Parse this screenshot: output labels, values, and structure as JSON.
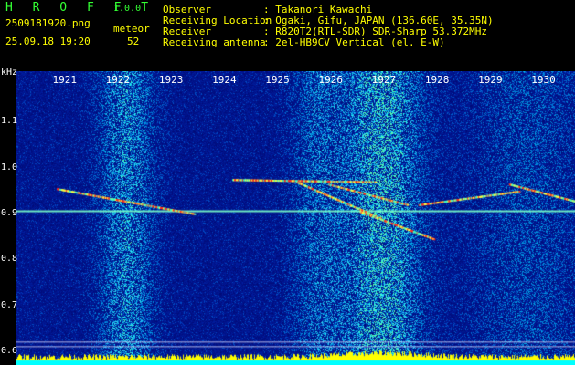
{
  "header": {
    "app_title": "H R O F F T",
    "app_version": "1.0.0",
    "file_name": "2509181920.png",
    "timestamp": "25.09.18 19:20",
    "meteor_label": "meteor",
    "meteor_count": "52",
    "info": [
      {
        "label": "Observer",
        "value": ": Takanori Kawachi"
      },
      {
        "label": "Receiving Location",
        "value": ": Ogaki, Gifu, JAPAN (136.60E, 35.35N)"
      },
      {
        "label": "Receiver",
        "value": ": R820T2(RTL-SDR) SDR-Sharp 53.372MHz"
      },
      {
        "label": "Receiving antenna",
        "value": ": 2el-HB9CV Vertical (el. E-W)"
      }
    ]
  },
  "colors": {
    "background": "#000000",
    "noise_base": "#0a1a8c",
    "title_green": "#33ff33",
    "timestamp_yellow": "#ffff00",
    "echo_red": "#ff3020",
    "echo_yellow": "#ffff40",
    "bottom_band_yellow": "#ffff00",
    "bottom_band_cyan": "#00ffff"
  },
  "chart_data": {
    "type": "heatmap",
    "ylabel": "kHz",
    "y_ticks": [
      "1.1",
      "1.0",
      "0.9",
      "0.8",
      "0.7",
      "0.6"
    ],
    "x_ticks": [
      "1921",
      "1922",
      "1923",
      "1924",
      "1925",
      "1926",
      "1927",
      "1928",
      "1929",
      "1930"
    ],
    "xlim": [
      "19:20",
      "19:30"
    ],
    "ylim": [
      0.57,
      1.21
    ],
    "grid": false,
    "carrier_khz": 0.905,
    "echoes": [
      {
        "t0": 0.0,
        "f0": 0.955,
        "t1": 2.6,
        "f1": 0.9
      },
      {
        "t0": 3.3,
        "f0": 0.975,
        "t1": 6.0,
        "f1": 0.97
      },
      {
        "t0": 4.5,
        "f0": 0.97,
        "t1": 6.1,
        "f1": 0.89
      },
      {
        "t0": 5.1,
        "f0": 0.965,
        "t1": 6.6,
        "f1": 0.92
      },
      {
        "t0": 6.8,
        "f0": 0.92,
        "t1": 8.7,
        "f1": 0.95
      },
      {
        "t0": 8.5,
        "f0": 0.965,
        "t1": 10.0,
        "f1": 0.92
      },
      {
        "t0": 5.7,
        "f0": 0.905,
        "t1": 7.1,
        "f1": 0.845
      }
    ]
  }
}
